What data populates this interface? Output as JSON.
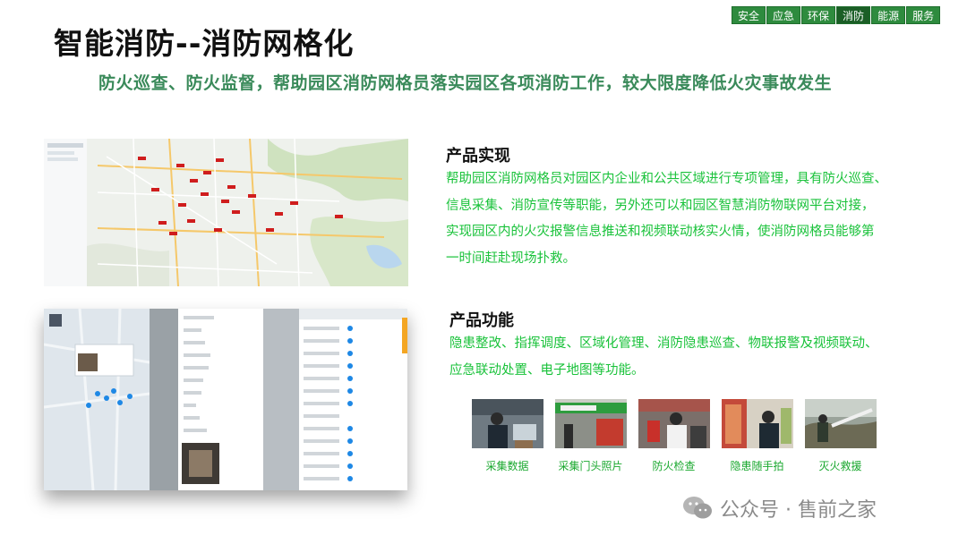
{
  "header": {
    "title": "智能消防--消防网格化",
    "subtitle": "防火巡查、防火监督，帮助园区消防网格员落实园区各项消防工作，较大限度降低火灾事故发生"
  },
  "nav": {
    "tabs": [
      {
        "label": "安全",
        "active": false
      },
      {
        "label": "应急",
        "active": false
      },
      {
        "label": "环保",
        "active": false
      },
      {
        "label": "消防",
        "active": true
      },
      {
        "label": "能源",
        "active": false
      },
      {
        "label": "服务",
        "active": false
      }
    ]
  },
  "implementation": {
    "heading": "产品实现",
    "lines": [
      "帮助园区消防网格员对园区内企业和公共区域进行专项管理，具有防火巡查、",
      "信息采集、消防宣传等职能，另外还可以和园区智慧消防物联网平台对接，",
      "实现园区内的火灾报警信息推送和视频联动核实火情，使消防网格员能够第",
      "一时间赶赴现场扑救。"
    ]
  },
  "functions": {
    "heading": "产品功能",
    "lines": [
      "隐患整改、指挥调度、区域化管理、消防隐患巡查、物联报警及视频联动、",
      "应急联动处置、电子地图等功能。"
    ]
  },
  "photos": [
    {
      "caption": "采集数据",
      "icon": "data-collection-photo"
    },
    {
      "caption": "采集门头照片",
      "icon": "storefront-photo"
    },
    {
      "caption": "防火检查",
      "icon": "fire-inspection-photo"
    },
    {
      "caption": "隐患随手拍",
      "icon": "hazard-snapshot-photo"
    },
    {
      "caption": "灭火救援",
      "icon": "fire-rescue-photo"
    }
  ],
  "watermark": {
    "text": "公众号 · 售前之家"
  },
  "colors": {
    "accent_green": "#19c23a",
    "subtitle_green": "#3a8a5a",
    "tab_green": "#2e8b3e"
  }
}
